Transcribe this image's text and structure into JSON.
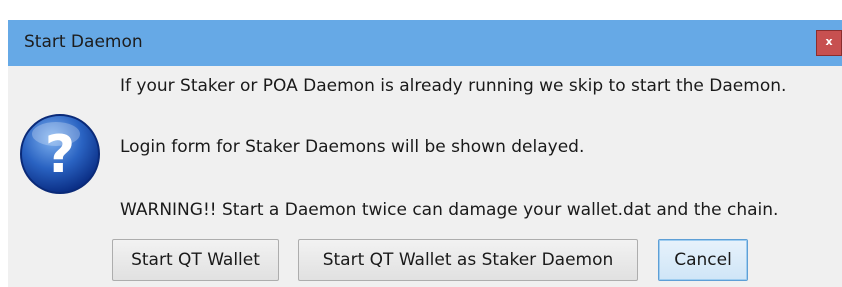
{
  "window": {
    "title": "Start Daemon",
    "close_label": "x"
  },
  "dialog": {
    "icon": "question-icon",
    "messages": [
      "If your Staker or POA Daemon is already running we skip to start the Daemon.",
      "Login form for Staker Daemons will be shown delayed.",
      "WARNING!! Start a Daemon twice can damage your wallet.dat and the chain."
    ]
  },
  "buttons": {
    "start_qt_wallet": "Start QT Wallet",
    "start_qt_wallet_staker": "Start QT Wallet as Staker Daemon",
    "cancel": "Cancel"
  },
  "colors": {
    "titlebar": "#66a9e6",
    "close": "#c75050",
    "client": "#f0f0f0",
    "default_button_border": "#5e9fd6"
  }
}
